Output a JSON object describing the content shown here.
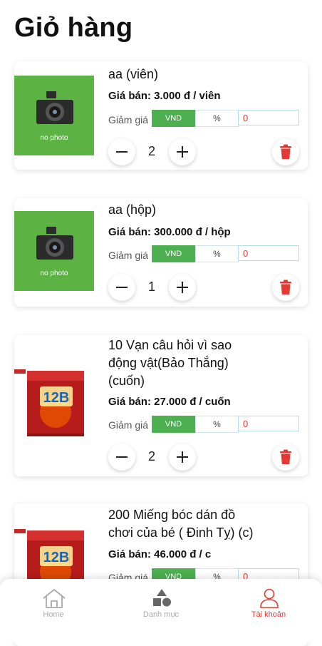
{
  "header": {
    "title": "Giỏ hàng"
  },
  "cart": {
    "items": [
      {
        "name_lines": [
          "aa (viên)"
        ],
        "price": "Giá bán: 3.000 đ / viên",
        "discount_label": "Giảm giá",
        "discount_vnd": "VND",
        "discount_pct": "%",
        "discount_value": "0",
        "quantity": "2",
        "thumb_type": "no-photo",
        "thumb_label": "no photo"
      },
      {
        "name_lines": [
          "aa (hộp)"
        ],
        "price": "Giá bán: 300.000 đ / hộp",
        "discount_label": "Giảm giá",
        "discount_vnd": "VND",
        "discount_pct": "%",
        "discount_value": "0",
        "quantity": "1",
        "thumb_type": "no-photo",
        "thumb_label": "no photo"
      },
      {
        "name_lines": [
          "10 Vạn câu hỏi vì sao",
          "động vật(Bảo Thắng)",
          "(cuốn)"
        ],
        "price": "Giá bán: 27.000 đ / cuốn",
        "discount_label": "Giảm giá",
        "discount_vnd": "VND",
        "discount_pct": "%",
        "discount_value": "0",
        "quantity": "2",
        "thumb_type": "product",
        "thumb_label": "12B"
      },
      {
        "name_lines": [
          "200  Miếng bóc dán đồ",
          "chơi của bé ( Đinh Tỵ) (c)"
        ],
        "price": "Giá bán: 46.000 đ / c",
        "discount_label": "Giảm giá",
        "discount_vnd": "VND",
        "discount_pct": "%",
        "discount_value": "0",
        "quantity": "",
        "thumb_type": "product",
        "thumb_label": "12B"
      }
    ]
  },
  "nav": {
    "items": [
      {
        "label": "Home",
        "icon": "home-icon",
        "active": false
      },
      {
        "label": "Danh mục",
        "icon": "category-icon",
        "active": false
      },
      {
        "label": "Tài khoản",
        "icon": "account-icon",
        "active": true
      }
    ]
  },
  "colors": {
    "accent": "#4caf50",
    "danger": "#e53935",
    "photo_bg": "#5cb343"
  }
}
